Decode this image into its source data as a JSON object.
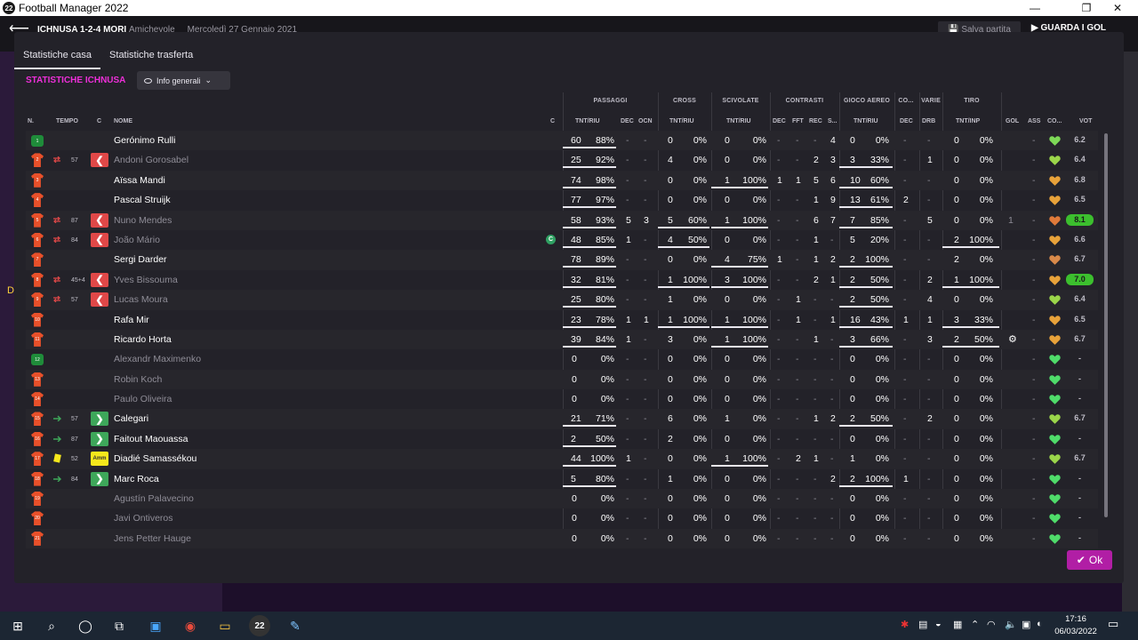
{
  "window": {
    "title": "Football Manager 2022",
    "logo": "22"
  },
  "header": {
    "match": "ICHNUSA 1-2-4 MORI",
    "competition": "Amichevole",
    "date": "Mercoledì 27 Gennaio 2021",
    "save_label": "Salva partita",
    "watch_label": "GUARDA I GOL",
    "side_letter": "D"
  },
  "tabs": [
    {
      "label": "Statistiche casa",
      "active": true
    },
    {
      "label": "Statistiche trasferta",
      "active": false
    }
  ],
  "section_title": "STATISTICHE ICHNUSA",
  "view_dropdown": "Info generali",
  "groups": [
    "PASSAGGI",
    "CROSS",
    "SCIVOLATE",
    "CONTRASTI",
    "GIOCO AEREO",
    "CO...",
    "VARIE",
    "TIRO"
  ],
  "columns": [
    "N.",
    "TEMPO",
    "C",
    "NOME",
    "C",
    "TNT/RIU",
    "DEC",
    "OCN",
    "TNT/RIU",
    "TNT/RIU",
    "DEC",
    "FFT",
    "REC",
    "S...",
    "TNT/RIU",
    "DEC",
    "DRB",
    "TNT/INP",
    "GOL",
    "ASS",
    "CO...",
    "VOT"
  ],
  "players": [
    {
      "name": "Gerónimo Rulli",
      "gk": true,
      "num": "1",
      "p": [
        "60",
        "88%",
        "-",
        "-"
      ],
      "cr": [
        "0",
        "0%"
      ],
      "sc": [
        "0",
        "0%"
      ],
      "ct": [
        "-",
        "-",
        "-",
        "4"
      ],
      "ga": [
        "0",
        "0%"
      ],
      "co": "-",
      "dr": "-",
      "ti": [
        "0",
        "0%"
      ],
      "gol": "",
      "ass": "-",
      "vot": "6.2",
      "hc": "#7ed957"
    },
    {
      "name": "Andoni Gorosabel",
      "num": "2",
      "sub": "out",
      "min": "57",
      "p": [
        "25",
        "92%",
        "-",
        "-"
      ],
      "cr": [
        "4",
        "0%"
      ],
      "sc": [
        "0",
        "0%"
      ],
      "ct": [
        "-",
        "-",
        "2",
        "3"
      ],
      "ga": [
        "3",
        "33%"
      ],
      "co": "-",
      "dr": "1",
      "ti": [
        "0",
        "0%"
      ],
      "gol": "",
      "ass": "-",
      "vot": "6.4",
      "hc": "#9bd64a",
      "dim": true,
      "ul": {
        "ga": true
      }
    },
    {
      "name": "Aïssa Mandi",
      "num": "3",
      "p": [
        "74",
        "98%",
        "-",
        "-"
      ],
      "cr": [
        "0",
        "0%"
      ],
      "sc": [
        "1",
        "100%"
      ],
      "ct": [
        "1",
        "1",
        "5",
        "6"
      ],
      "ga": [
        "10",
        "60%"
      ],
      "co": "-",
      "dr": "-",
      "ti": [
        "0",
        "0%"
      ],
      "gol": "",
      "ass": "-",
      "vot": "6.8",
      "hc": "#e8a23a",
      "ul": {
        "sc": true,
        "ga": true
      }
    },
    {
      "name": "Pascal Struijk",
      "num": "4",
      "p": [
        "77",
        "97%",
        "-",
        "-"
      ],
      "cr": [
        "0",
        "0%"
      ],
      "sc": [
        "0",
        "0%"
      ],
      "ct": [
        "-",
        "-",
        "1",
        "9"
      ],
      "ga": [
        "13",
        "61%"
      ],
      "co": "2",
      "dr": "-",
      "ti": [
        "0",
        "0%"
      ],
      "gol": "",
      "ass": "-",
      "vot": "6.5",
      "hc": "#e8a23a",
      "ul": {
        "ga": true
      }
    },
    {
      "name": "Nuno Mendes",
      "num": "5",
      "sub": "out",
      "min": "87",
      "p": [
        "58",
        "93%",
        "5",
        "3"
      ],
      "cr": [
        "5",
        "60%"
      ],
      "sc": [
        "1",
        "100%"
      ],
      "ct": [
        "-",
        "-",
        "6",
        "7"
      ],
      "ga": [
        "7",
        "85%"
      ],
      "co": "-",
      "dr": "5",
      "ti": [
        "0",
        "0%"
      ],
      "gol": "1",
      "ass": "-",
      "vot": "8.1",
      "hc": "#e07a3a",
      "dim": true,
      "hi": true,
      "ul": {
        "cr": true,
        "sc": true,
        "ga": true
      }
    },
    {
      "name": "João Mário",
      "num": "6",
      "sub": "out",
      "min": "84",
      "cap": "C",
      "p": [
        "48",
        "85%",
        "1",
        "-"
      ],
      "cr": [
        "4",
        "50%"
      ],
      "sc": [
        "0",
        "0%"
      ],
      "ct": [
        "-",
        "-",
        "1",
        "-"
      ],
      "ga": [
        "5",
        "20%"
      ],
      "co": "-",
      "dr": "-",
      "ti": [
        "2",
        "100%"
      ],
      "gol": "",
      "ass": "-",
      "vot": "6.6",
      "hc": "#e8a23a",
      "dim": true,
      "ul": {
        "cr": true,
        "ti": true
      }
    },
    {
      "name": "Sergi Darder",
      "num": "7",
      "p": [
        "78",
        "89%",
        "-",
        "-"
      ],
      "cr": [
        "0",
        "0%"
      ],
      "sc": [
        "4",
        "75%"
      ],
      "ct": [
        "1",
        "-",
        "1",
        "2"
      ],
      "ga": [
        "2",
        "100%"
      ],
      "co": "-",
      "dr": "-",
      "ti": [
        "2",
        "0%"
      ],
      "gol": "",
      "ass": "-",
      "vot": "6.7",
      "hc": "#d98a4a",
      "ul": {
        "sc": true,
        "ga": true
      }
    },
    {
      "name": "Yves Bissouma",
      "num": "8",
      "sub": "out",
      "min": "45+4",
      "p": [
        "32",
        "81%",
        "-",
        "-"
      ],
      "cr": [
        "1",
        "100%"
      ],
      "sc": [
        "3",
        "100%"
      ],
      "ct": [
        "-",
        "-",
        "2",
        "1"
      ],
      "ga": [
        "2",
        "50%"
      ],
      "co": "-",
      "dr": "2",
      "ti": [
        "1",
        "100%"
      ],
      "gol": "",
      "ass": "-",
      "vot": "7.0",
      "hc": "#e8a23a",
      "dim": true,
      "hi": true,
      "ul": {
        "cr": true,
        "sc": true,
        "ga": true,
        "ti": true
      }
    },
    {
      "name": "Lucas Moura",
      "num": "9",
      "sub": "out",
      "min": "57",
      "p": [
        "25",
        "80%",
        "-",
        "-"
      ],
      "cr": [
        "1",
        "0%"
      ],
      "sc": [
        "0",
        "0%"
      ],
      "ct": [
        "-",
        "1",
        "-",
        "-"
      ],
      "ga": [
        "2",
        "50%"
      ],
      "co": "-",
      "dr": "4",
      "ti": [
        "0",
        "0%"
      ],
      "gol": "",
      "ass": "-",
      "vot": "6.4",
      "hc": "#9bd64a",
      "dim": true,
      "ul": {
        "ga": true
      }
    },
    {
      "name": "Rafa Mir",
      "num": "10",
      "p": [
        "23",
        "78%",
        "1",
        "1"
      ],
      "cr": [
        "1",
        "100%"
      ],
      "sc": [
        "1",
        "100%"
      ],
      "ct": [
        "-",
        "1",
        "-",
        "1"
      ],
      "ga": [
        "16",
        "43%"
      ],
      "co": "1",
      "dr": "1",
      "ti": [
        "3",
        "33%"
      ],
      "gol": "",
      "ass": "-",
      "vot": "6.5",
      "hc": "#e8a23a",
      "ul": {
        "cr": true,
        "sc": true,
        "ga": true,
        "ti": true
      }
    },
    {
      "name": "Ricardo Horta",
      "num": "11",
      "p": [
        "39",
        "84%",
        "1",
        "-"
      ],
      "cr": [
        "3",
        "0%"
      ],
      "sc": [
        "1",
        "100%"
      ],
      "ct": [
        "-",
        "-",
        "1",
        "-"
      ],
      "ga": [
        "3",
        "66%"
      ],
      "co": "-",
      "dr": "3",
      "ti": [
        "2",
        "50%"
      ],
      "gol": "⚙",
      "ass": "-",
      "vot": "6.7",
      "hc": "#e8a23a",
      "ul": {
        "sc": true,
        "ga": true,
        "ti": true
      }
    },
    {
      "name": "Alexandr Maximenko",
      "gk": true,
      "num": "12",
      "p": [
        "0",
        "0%",
        "-",
        "-"
      ],
      "cr": [
        "0",
        "0%"
      ],
      "sc": [
        "0",
        "0%"
      ],
      "ct": [
        "-",
        "-",
        "-",
        "-"
      ],
      "ga": [
        "0",
        "0%"
      ],
      "co": "-",
      "dr": "-",
      "ti": [
        "0",
        "0%"
      ],
      "gol": "",
      "ass": "-",
      "vot": "-",
      "hc": "#4fdc6a",
      "dim": true,
      "nop": true
    },
    {
      "name": "Robin Koch",
      "num": "13",
      "p": [
        "0",
        "0%",
        "-",
        "-"
      ],
      "cr": [
        "0",
        "0%"
      ],
      "sc": [
        "0",
        "0%"
      ],
      "ct": [
        "-",
        "-",
        "-",
        "-"
      ],
      "ga": [
        "0",
        "0%"
      ],
      "co": "-",
      "dr": "-",
      "ti": [
        "0",
        "0%"
      ],
      "gol": "",
      "ass": "-",
      "vot": "-",
      "hc": "#4fdc6a",
      "dim": true,
      "nop": true
    },
    {
      "name": "Paulo Oliveira",
      "num": "14",
      "p": [
        "0",
        "0%",
        "-",
        "-"
      ],
      "cr": [
        "0",
        "0%"
      ],
      "sc": [
        "0",
        "0%"
      ],
      "ct": [
        "-",
        "-",
        "-",
        "-"
      ],
      "ga": [
        "0",
        "0%"
      ],
      "co": "-",
      "dr": "-",
      "ti": [
        "0",
        "0%"
      ],
      "gol": "",
      "ass": "-",
      "vot": "-",
      "hc": "#4fdc6a",
      "dim": true,
      "nop": true
    },
    {
      "name": "Calegari",
      "num": "15",
      "sub": "in",
      "min": "57",
      "p": [
        "21",
        "71%",
        "-",
        "-"
      ],
      "cr": [
        "6",
        "0%"
      ],
      "sc": [
        "1",
        "0%"
      ],
      "ct": [
        "-",
        "-",
        "1",
        "2"
      ],
      "ga": [
        "2",
        "50%"
      ],
      "co": "-",
      "dr": "2",
      "ti": [
        "0",
        "0%"
      ],
      "gol": "",
      "ass": "-",
      "vot": "6.7",
      "hc": "#9bd64a",
      "ul": {
        "ga": true
      }
    },
    {
      "name": "Faitout Maouassa",
      "num": "16",
      "sub": "in",
      "min": "87",
      "p": [
        "2",
        "50%",
        "-",
        "-"
      ],
      "cr": [
        "2",
        "0%"
      ],
      "sc": [
        "0",
        "0%"
      ],
      "ct": [
        "-",
        "-",
        "-",
        "-"
      ],
      "ga": [
        "0",
        "0%"
      ],
      "co": "-",
      "dr": "-",
      "ti": [
        "0",
        "0%"
      ],
      "gol": "",
      "ass": "-",
      "vot": "-",
      "hc": "#4fdc6a"
    },
    {
      "name": "Diadié Samassékou",
      "num": "17",
      "sub": "amm",
      "min": "52",
      "amm": "Amm",
      "p": [
        "44",
        "100%",
        "1",
        "-"
      ],
      "cr": [
        "0",
        "0%"
      ],
      "sc": [
        "1",
        "100%"
      ],
      "ct": [
        "-",
        "2",
        "1",
        "-"
      ],
      "ga": [
        "1",
        "0%"
      ],
      "co": "-",
      "dr": "-",
      "ti": [
        "0",
        "0%"
      ],
      "gol": "",
      "ass": "-",
      "vot": "6.7",
      "hc": "#9bd64a",
      "ul": {
        "sc": true
      }
    },
    {
      "name": "Marc Roca",
      "num": "18",
      "sub": "in",
      "min": "84",
      "p": [
        "5",
        "80%",
        "-",
        "-"
      ],
      "cr": [
        "1",
        "0%"
      ],
      "sc": [
        "0",
        "0%"
      ],
      "ct": [
        "-",
        "-",
        "-",
        "2"
      ],
      "ga": [
        "2",
        "100%"
      ],
      "co": "1",
      "dr": "-",
      "ti": [
        "0",
        "0%"
      ],
      "gol": "",
      "ass": "-",
      "vot": "-",
      "hc": "#4fdc6a",
      "ul": {
        "ga": true
      }
    },
    {
      "name": "Agustín Palavecino",
      "num": "19",
      "p": [
        "0",
        "0%",
        "-",
        "-"
      ],
      "cr": [
        "0",
        "0%"
      ],
      "sc": [
        "0",
        "0%"
      ],
      "ct": [
        "-",
        "-",
        "-",
        "-"
      ],
      "ga": [
        "0",
        "0%"
      ],
      "co": "-",
      "dr": "-",
      "ti": [
        "0",
        "0%"
      ],
      "gol": "",
      "ass": "-",
      "vot": "-",
      "hc": "#4fdc6a",
      "dim": true,
      "nop": true
    },
    {
      "name": "Javi Ontiveros",
      "num": "20",
      "p": [
        "0",
        "0%",
        "-",
        "-"
      ],
      "cr": [
        "0",
        "0%"
      ],
      "sc": [
        "0",
        "0%"
      ],
      "ct": [
        "-",
        "-",
        "-",
        "-"
      ],
      "ga": [
        "0",
        "0%"
      ],
      "co": "-",
      "dr": "-",
      "ti": [
        "0",
        "0%"
      ],
      "gol": "",
      "ass": "-",
      "vot": "-",
      "hc": "#4fdc6a",
      "dim": true,
      "nop": true
    },
    {
      "name": "Jens Petter Hauge",
      "num": "21",
      "p": [
        "0",
        "0%",
        "-",
        "-"
      ],
      "cr": [
        "0",
        "0%"
      ],
      "sc": [
        "0",
        "0%"
      ],
      "ct": [
        "-",
        "-",
        "-",
        "-"
      ],
      "ga": [
        "0",
        "0%"
      ],
      "co": "-",
      "dr": "-",
      "ti": [
        "0",
        "0%"
      ],
      "gol": "",
      "ass": "-",
      "vot": "-",
      "hc": "#4fdc6a",
      "dim": true,
      "nop": true
    }
  ],
  "ok_label": "Ok",
  "taskbar": {
    "time": "17:16",
    "date": "06/03/2022",
    "fm_label": "22"
  },
  "colors": {
    "accent": "#ee2fd9",
    "ok_button": "#b11ea5",
    "vote_high": "#3cbf2e",
    "sub_out": "#e04848",
    "sub_in": "#3ea75a",
    "yellow_card": "#f6e81c"
  }
}
